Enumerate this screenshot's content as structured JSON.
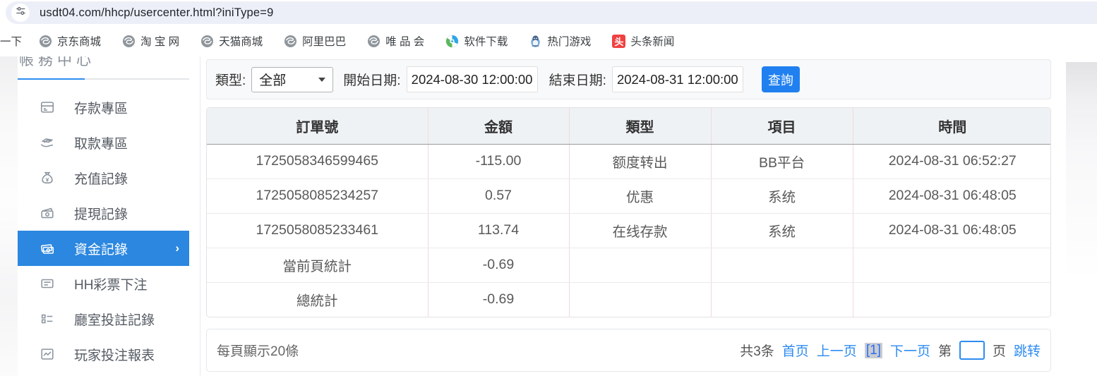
{
  "browser": {
    "url": "usdt04.com/hhcp/usercenter.html?iniType=9",
    "bookmarks": [
      {
        "label": "一下",
        "icon": "none"
      },
      {
        "label": "京东商城",
        "icon": "globe-gray"
      },
      {
        "label": "淘 宝 网",
        "icon": "globe-gray"
      },
      {
        "label": "天猫商城",
        "icon": "globe-gray"
      },
      {
        "label": "阿里巴巴",
        "icon": "globe-gray"
      },
      {
        "label": "唯 品 会",
        "icon": "globe-gray"
      },
      {
        "label": "软件下载",
        "icon": "download-blue-green"
      },
      {
        "label": "热门游戏",
        "icon": "penguin-blue"
      },
      {
        "label": "头条新闻",
        "icon": "toutiao-red",
        "icon_glyph": "头"
      }
    ]
  },
  "sidebar": {
    "header_clipped_text": "帳務中心",
    "items": [
      {
        "label": "存款專區",
        "icon": "deposit-machine-icon",
        "active": false
      },
      {
        "label": "取款專區",
        "icon": "withdraw-hand-icon",
        "active": false
      },
      {
        "label": "充值記錄",
        "icon": "moneybag-icon",
        "active": false
      },
      {
        "label": "提現記錄",
        "icon": "banknote-out-icon",
        "active": false
      },
      {
        "label": "資金記錄",
        "icon": "cash-stack-icon",
        "active": true
      },
      {
        "label": "HH彩票下注",
        "icon": "ticket-list-icon",
        "active": false
      },
      {
        "label": "廳室投註記錄",
        "icon": "detail-list-icon",
        "active": false
      },
      {
        "label": "玩家投注報表",
        "icon": "chart-report-icon",
        "active": false
      }
    ]
  },
  "filter": {
    "type_label": "類型:",
    "type_value": "全部",
    "start_label": "開始日期:",
    "start_value": "2024-08-30 12:00:00",
    "end_label": "結束日期:",
    "end_value": "2024-08-31 12:00:00",
    "search_button": "查詢"
  },
  "table": {
    "headers": [
      "訂單號",
      "金額",
      "類型",
      "項目",
      "時間"
    ],
    "rows": [
      [
        "1725058346599465",
        "-115.00",
        "额度转出",
        "BB平台",
        "2024-08-31 06:52:27"
      ],
      [
        "1725058085234257",
        "0.57",
        "优惠",
        "系统",
        "2024-08-31 06:48:05"
      ],
      [
        "1725058085233461",
        "113.74",
        "在线存款",
        "系统",
        "2024-08-31 06:48:05"
      ],
      [
        "當前頁統計",
        "-0.69",
        "",
        "",
        ""
      ],
      [
        "總統計",
        "-0.69",
        "",
        "",
        ""
      ]
    ]
  },
  "pagination": {
    "page_size_text": "每頁顯示20條",
    "total_text": "共3条",
    "first": "首页",
    "prev": "上一页",
    "current": "[1]",
    "next": "下一页",
    "jump_prefix": "第",
    "jump_input_value": "",
    "jump_suffix": "页",
    "jump_button": "跳转"
  },
  "colors": {
    "accent_blue": "#2b87e0",
    "button_blue": "#2080f0",
    "link_blue": "#2d8cf0",
    "toutiao_red": "#f04142",
    "table_header_bg": "#eff2f5",
    "table_pink_border": "#f2dada",
    "addressbar_bg": "#eceff7"
  }
}
